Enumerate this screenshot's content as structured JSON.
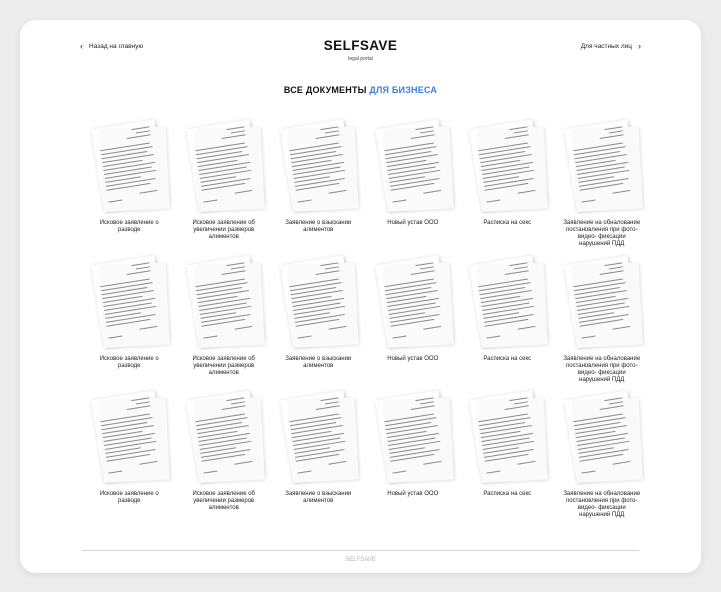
{
  "header": {
    "back_label": "Назад на главную",
    "brand_title": "SELFSAVE",
    "brand_subtitle": "legal portal",
    "private_label": "Для частных лиц"
  },
  "heading": {
    "main": "ВСЕ ДОКУМЕНТЫ ",
    "accent": "ДЛЯ БИЗНЕСА"
  },
  "documents": [
    {
      "title": "Исковое заявление о разводе"
    },
    {
      "title": "Исковое заявление об увеличении размеров алиментов"
    },
    {
      "title": "Заявление о взыскании алиментов"
    },
    {
      "title": "Новый устав ООО"
    },
    {
      "title": "Расписка на секс"
    },
    {
      "title": "Заявление на обналование постановления при фото-видео- фиксации нарушений ПДД"
    },
    {
      "title": "Исковое заявление о разводе"
    },
    {
      "title": "Исковое заявление об увеличении размеров алиментов"
    },
    {
      "title": "Заявление о взыскании алиментов"
    },
    {
      "title": "Новый устав ООО"
    },
    {
      "title": "Расписка на секс"
    },
    {
      "title": "Заявление на обналование постановления при фото-видео- фиксации нарушений ПДД"
    },
    {
      "title": "Исковое заявление о разводе"
    },
    {
      "title": "Исковое заявление об увеличении размеров алиментов"
    },
    {
      "title": "Заявление о взыскании алиментов"
    },
    {
      "title": "Новый устав ООО"
    },
    {
      "title": "Расписка на секс"
    },
    {
      "title": "Заявление на обналование постановления при фото-видео- фиксации нарушений ПДД"
    }
  ],
  "footer": {
    "text": "SELFSAVE"
  },
  "icons": {
    "back": "chevron-left-icon",
    "forward": "chevron-right-icon"
  },
  "colors": {
    "accent": "#3b7fe0",
    "background": "#ececec",
    "card": "#ffffff"
  }
}
